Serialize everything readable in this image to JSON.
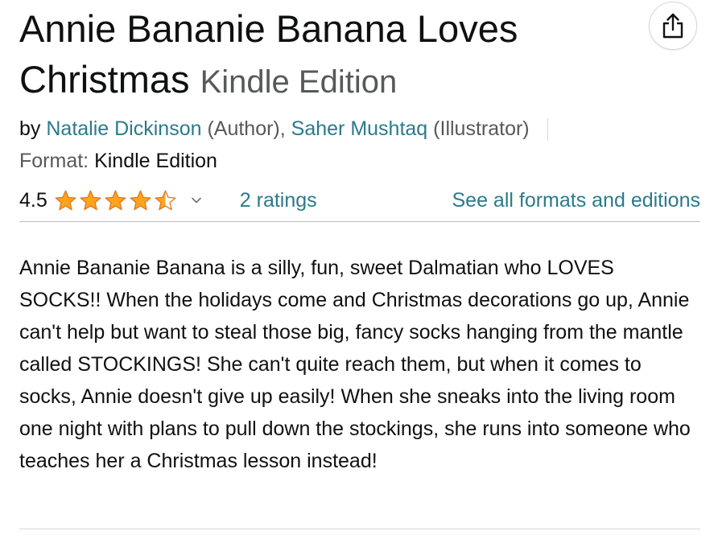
{
  "product": {
    "title": "Annie Bananie Banana Loves Christmas",
    "edition": "Kindle Edition",
    "byline": {
      "by": "by",
      "contributors": [
        {
          "name": "Natalie Dickinson",
          "role": "(Author)"
        },
        {
          "name": "Saher Mushtaq",
          "role": "(Illustrator)"
        }
      ],
      "separator": ","
    },
    "format": {
      "label": "Format:",
      "value": "Kindle Edition"
    },
    "rating": {
      "value": "4.5",
      "stars_filled": 4.5,
      "stars_total": 5,
      "ratings_link": "2 ratings",
      "star_color": "#ffa41c"
    },
    "formats_link": "See all formats and editions",
    "description": "Annie Bananie Banana is a silly, fun, sweet Dalmatian who LOVES SOCKS!! When the holidays come and Christmas decorations go up, Annie can't help but want to steal those big, fancy socks hanging from the mantle called STOCKINGS! She can't quite reach them, but when it comes to socks, Annie doesn't give up easily! When she sneaks into the living room one night with plans to pull down the stockings, she runs into someone who teaches her a Christmas lesson instead!"
  },
  "icons": {
    "share": "share-icon",
    "chevron": "chevron-down-icon",
    "star": "star-icon"
  },
  "colors": {
    "link": "#2b7a8b",
    "star": "#ffa41c",
    "text": "#0f1111",
    "muted": "#565959"
  }
}
